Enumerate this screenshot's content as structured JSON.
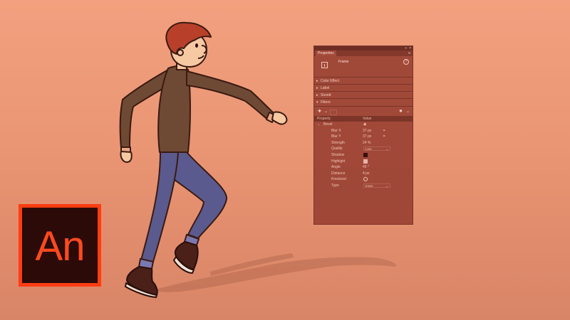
{
  "colors": {
    "background": "#ea9674",
    "panel": "#963e30",
    "logo_border": "#ff3d12",
    "logo_bg": "#2b0a08",
    "logo_text": "#ff4a1d"
  },
  "logo": {
    "text": "An"
  },
  "panel": {
    "tab": "Properties",
    "frame_label": "Frame",
    "help_icon": "question-icon",
    "sections": [
      "Color Effect",
      "Label",
      "Sound"
    ],
    "filters_section": "Filters",
    "table_headers": {
      "property": "Property",
      "value": "Value"
    },
    "filter_name": "Bevel",
    "rows": [
      {
        "label": "Blur X",
        "value": "37 px",
        "control": "text",
        "linked": true
      },
      {
        "label": "Blur Y",
        "value": "37 px",
        "control": "text",
        "linked": true
      },
      {
        "label": "Strength",
        "value": "24 %",
        "control": "text"
      },
      {
        "label": "Quality",
        "value": "Low",
        "control": "select"
      },
      {
        "label": "Shadow",
        "value": "",
        "control": "swatch",
        "color": "#3a0f0b"
      },
      {
        "label": "Highlight",
        "value": "",
        "control": "swatch",
        "color": "#e9b3ab"
      },
      {
        "label": "Angle",
        "value": "45 °",
        "control": "text"
      },
      {
        "label": "Distance",
        "value": "4 px",
        "control": "text"
      },
      {
        "label": "Knockout",
        "value": "",
        "control": "radio"
      },
      {
        "label": "Type",
        "value": "Inner",
        "control": "select"
      }
    ]
  }
}
